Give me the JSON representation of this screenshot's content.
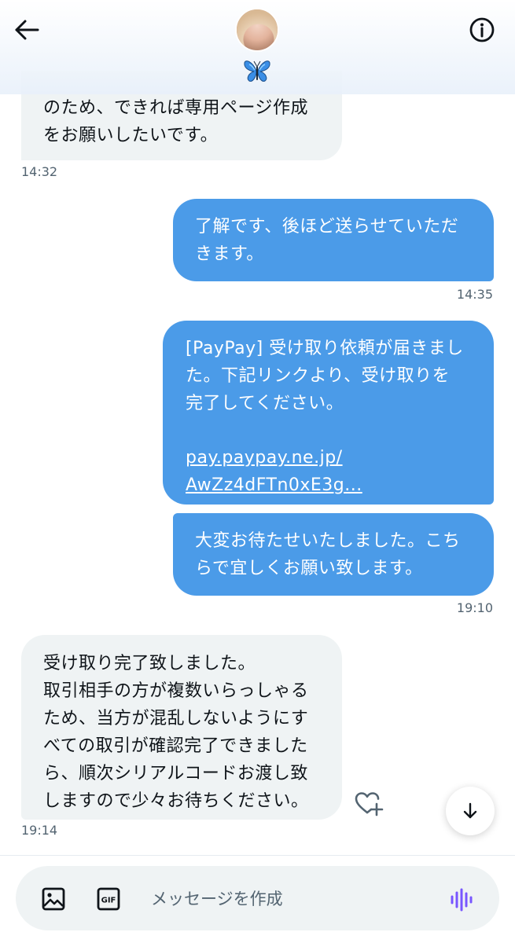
{
  "header": {
    "back_icon": "arrow-left-icon",
    "info_icon": "info-circle-icon",
    "name_emoji": "butterfly-emoji"
  },
  "messages": [
    {
      "side": "received",
      "text": "のため、できれば専用ページ作成\nをお願いしたいです。",
      "time": "14:32"
    },
    {
      "side": "sent",
      "text": "了解です、後ほど送らせていただ\nきます。",
      "time": "14:35"
    },
    {
      "side": "sent",
      "text": "[PayPay] 受け取り依頼が届きまし\nた。下記リンクより、受け取りを\n完了してください。",
      "link1": "pay.paypay.ne.jp/",
      "link2": "AwZz4dFTn0xE3g..."
    },
    {
      "side": "sent",
      "text": "大変お待たせいたしました。こち\nらで宜しくお願い致します。",
      "time": "19:10"
    },
    {
      "side": "received",
      "text": "受け取り完了致しました。\n取引相手の方が複数いらっしゃる\nため、当方が混乱しないようにす\nべての取引が確認完了できました\nら、順次シリアルコードお渡し致\nしますので少々お待ちください。",
      "time": "19:14"
    }
  ],
  "composer": {
    "placeholder": "メッセージを作成",
    "media_icon": "image-icon",
    "gif_label": "GIF",
    "voice_icon": "voice-wave-icon",
    "accent": "#7856ff"
  },
  "colors": {
    "sent_bubble": "#4b9be8",
    "received_bubble": "#eff3f4"
  }
}
